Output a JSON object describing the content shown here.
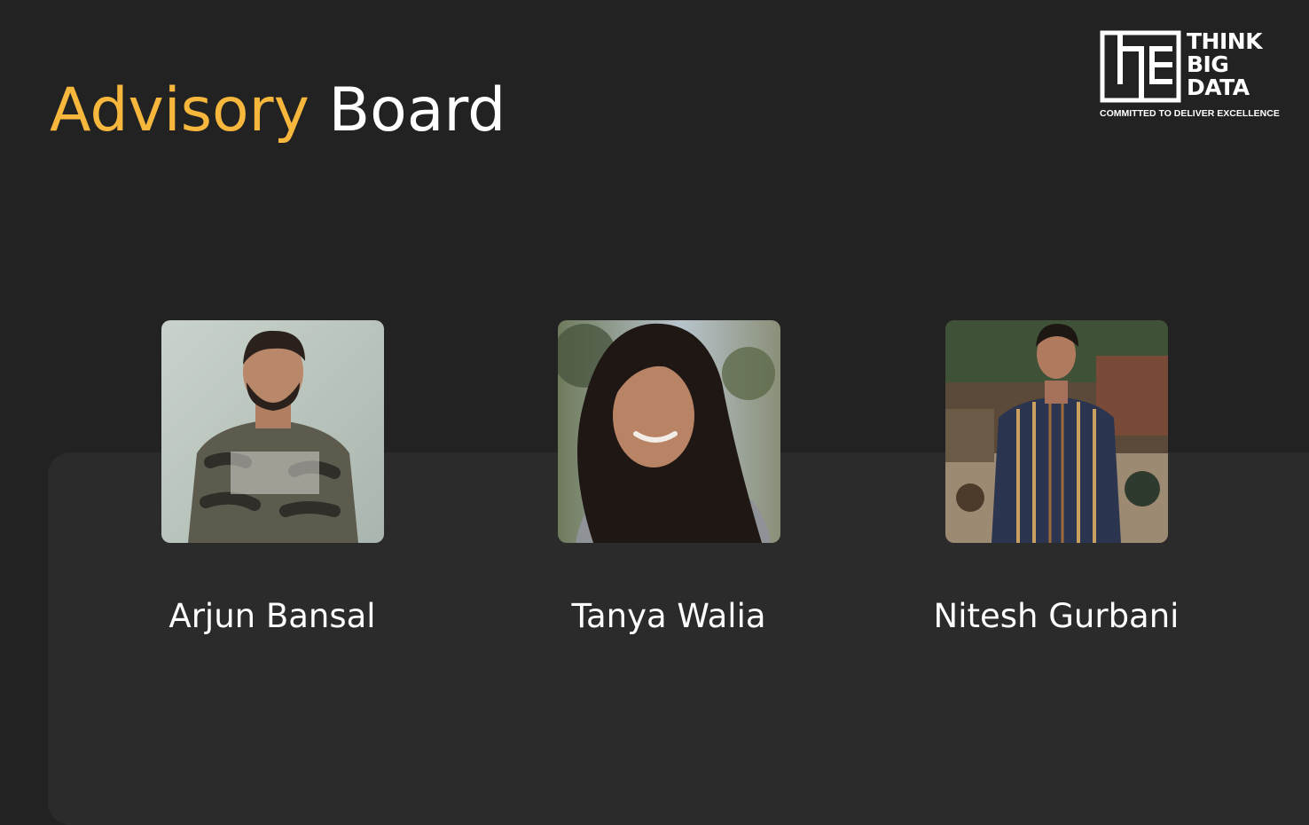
{
  "header": {
    "title_accent": "Advisory",
    "title_rest": "Board"
  },
  "logo": {
    "line1": "THINK",
    "line2": "BIG",
    "line3": "DATA",
    "tagline": "COMMITTED TO DELIVER EXCELLENCE"
  },
  "members": [
    {
      "name": "Arjun Bansal"
    },
    {
      "name": "Tanya Walia"
    },
    {
      "name": "Nitesh Gurbani"
    }
  ],
  "colors": {
    "background": "#222222",
    "panel": "#2b2b2b",
    "accent": "#f6b73c",
    "text": "#ffffff"
  }
}
